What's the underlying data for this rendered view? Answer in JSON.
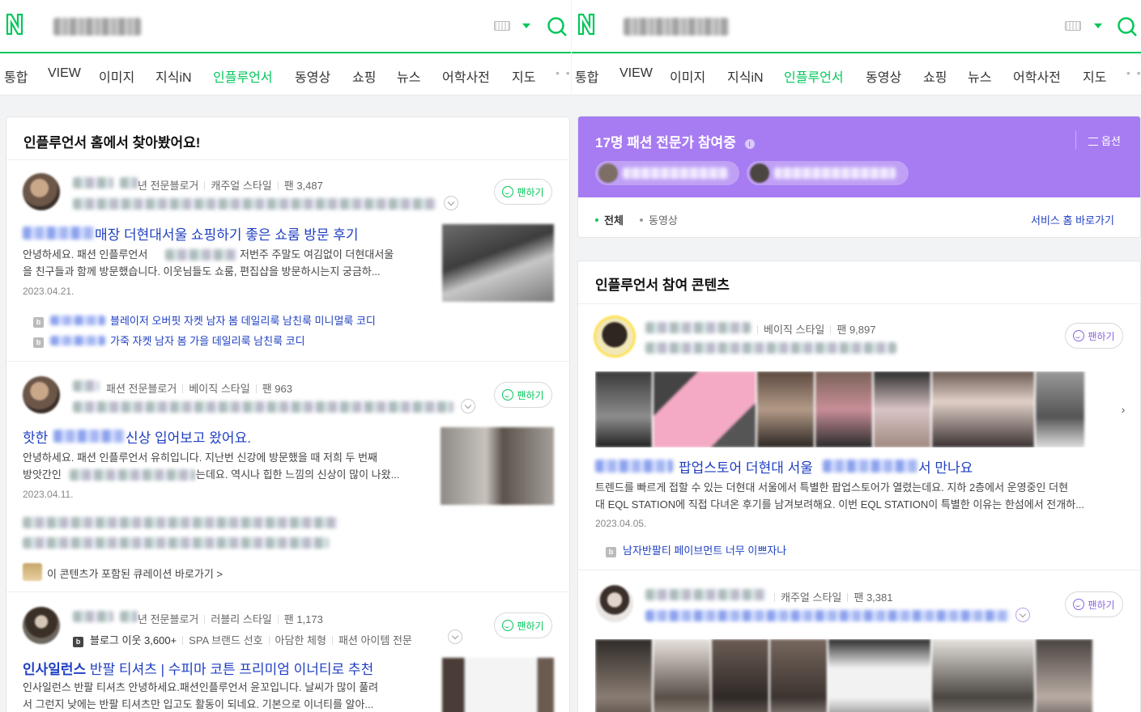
{
  "colors": {
    "brand_green": "#03c75a",
    "link_blue": "#1f3fc2",
    "purple": "#a77cf2"
  },
  "tabs": [
    "통합",
    "VIEW",
    "이미지",
    "지식iN",
    "인플루언서",
    "동영상",
    "쇼핑",
    "뉴스",
    "어학사전",
    "지도"
  ],
  "active_tab": "인플루언서",
  "tab_more": "• •",
  "left": {
    "card_title": "인플루언서 홈에서 찾아봤어요!",
    "posts": [
      {
        "meta": [
          "년 전문블로거",
          "캐주얼 스타일",
          "팬 3,487"
        ],
        "fan_label": "팬하기",
        "title": "매장 더현대서울 쇼핑하기 좋은 쇼룸 방문 후기",
        "desc1": "안녕하세요. 패션 인플루언서",
        "desc1b": "저번주 주말도 여김없이 더현대서울",
        "desc2": "을 친구들과 함께 방문했습니다. 이웃님들도 쇼룸, 편집샵을 방문하시는지 궁금하...",
        "date": "2023.04.21.",
        "links": [
          "블레이저 오버핏 자켓 남자 봄 데일리룩 남친룩 미니멀룩 코디",
          "가죽 자켓 남자 봄 가을 데일리룩 남친룩 코디"
        ]
      },
      {
        "meta": [
          "패션 전문블로거",
          "베이직 스타일",
          "팬 963"
        ],
        "fan_label": "팬하기",
        "title_pre": "핫한",
        "title_post": "신상 입어보고 왔어요.",
        "desc1": "안녕하세요. 패션 인플루언서 유히입니다. 지난번 신강에 방문했을 때 저희 두 번째",
        "desc2a": "방앗간인",
        "desc2b": "는데요. 역시나 힙한 느낌의 신상이 많이 나왔...",
        "date": "2023.04.11.",
        "curation": "이 콘텐츠가 포함된 큐레이션 바로가기 >"
      },
      {
        "meta": [
          "년 전문블로거",
          "러블리 스타일",
          "팬 1,173"
        ],
        "meta2": [
          "블로그 이웃 3,600+",
          "SPA 브랜드 선호",
          "아담한 체형",
          "패션 아이템 전문"
        ],
        "fan_label": "팬하기",
        "title_bold": "인사일런스",
        "title_rest": " 반팔 티셔츠 | 수피마 코튼 프리미엄 이너티로 추천",
        "desc1": "인사일런스 반팔 티셔츠 안녕하세요.패션인플루언서 윤꼬입니다. 날씨가 많이 풀려",
        "desc2": "서 그런지 낮에는 반팔 티셔츠만 입고도 활동이 되네요. 기본으로 이너티를 알아..."
      }
    ]
  },
  "right": {
    "header_title": "17명 패션 전문가 참여중",
    "options_label": "옵션",
    "filters": [
      "전체",
      "동영상"
    ],
    "service_link": "서비스 홈 바로가기",
    "card_title": "인플루언서 참여 콘텐츠",
    "posts": [
      {
        "meta": [
          "베이직 스타일",
          "팬 9,897"
        ],
        "fan_label": "팬하기",
        "title_a": "팝업스토어 더현대 서울",
        "title_b": "서 만나요",
        "desc1": "트렌드를 빠르게 접할 수 있는 더현대 서울에서 특별한 팝업스토어가 열렸는데요. 지하 2층에서 운영중인 더현",
        "desc2": "대 EQL STATION에 직접 다녀온 후기를 남겨보려해요. 이번 EQL STATION이 특별한 이유는 한섬에서 전개하...",
        "date": "2023.04.05.",
        "link": "남자반팔티 페이브먼트 너무 이쁘자나"
      },
      {
        "meta": [
          "캐주얼 스타일",
          "팬 3,381"
        ],
        "fan_label": "팬하기"
      }
    ]
  }
}
